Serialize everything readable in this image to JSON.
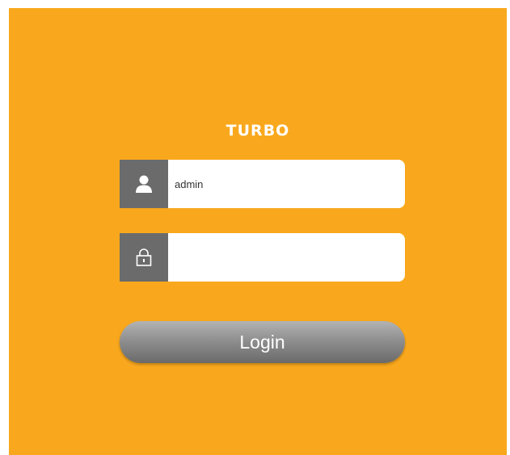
{
  "brand": {
    "title": "TURBO",
    "accent_color": "#f9a81d"
  },
  "form": {
    "username": {
      "icon": "user-icon",
      "value": "admin",
      "placeholder": ""
    },
    "password": {
      "icon": "lock-icon",
      "value": "",
      "placeholder": ""
    },
    "login_label": "Login"
  }
}
